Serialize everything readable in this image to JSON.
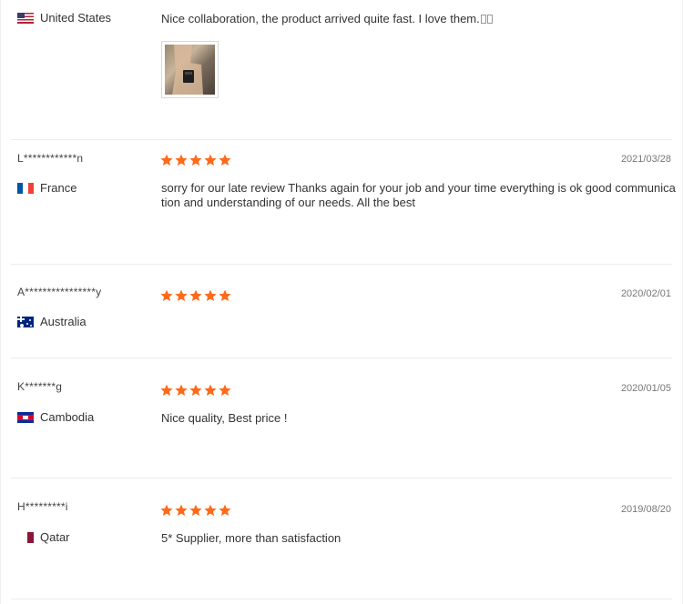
{
  "colors": {
    "star": "#ff6a1a",
    "divider": "#ececec",
    "text": "#333333",
    "date": "#777777"
  },
  "reviews": [
    {
      "user": "",
      "country": "United States",
      "flag_icon": "us-flag-icon",
      "rating": null,
      "date": "",
      "text": "Nice collaboration, the product arrived quite fast. I love them.",
      "has_photo": true
    },
    {
      "user": "L************n",
      "country": "France",
      "flag_icon": "france-flag-icon",
      "rating": 5,
      "date": "2021/03/28",
      "text": "sorry for our late review  Thanks again for your job and your time everything is ok good communication and understanding of our needs. All the best"
    },
    {
      "user": "A****************y",
      "country": "Australia",
      "flag_icon": "australia-flag-icon",
      "rating": 5,
      "date": "2020/02/01",
      "text": ""
    },
    {
      "user": "K*******g",
      "country": "Cambodia",
      "flag_icon": "cambodia-flag-icon",
      "rating": 5,
      "date": "2020/01/05",
      "text": "Nice quality, Best price !"
    },
    {
      "user": "H*********i",
      "country": "Qatar",
      "flag_icon": "qatar-flag-icon",
      "rating": 5,
      "date": "2019/08/20",
      "text": "5* Supplier, more than satisfaction"
    }
  ]
}
